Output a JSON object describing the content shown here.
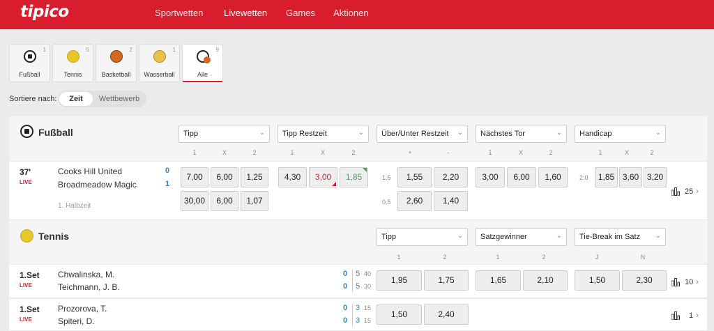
{
  "brand": {
    "logo": "tipico",
    "red": "#d81e2e"
  },
  "nav": [
    "Sportwetten",
    "Livewetten",
    "Games",
    "Aktionen"
  ],
  "sport_tabs": [
    {
      "label": "Fußball",
      "count": "1",
      "icon": "soccer-ball-icon"
    },
    {
      "label": "Tennis",
      "count": "5",
      "icon": "tennis-ball-icon"
    },
    {
      "label": "Basketball",
      "count": "2",
      "icon": "basketball-icon"
    },
    {
      "label": "Wasserball",
      "count": "1",
      "icon": "waterpolo-ball-icon"
    },
    {
      "label": "Alle",
      "count": "9",
      "icon": "all-sports-icon"
    }
  ],
  "sort": {
    "label": "Sortiere nach:",
    "options": [
      "Zeit",
      "Wettbewerb"
    ],
    "selected": "Zeit"
  },
  "football": {
    "title": "Fußball",
    "markets": [
      {
        "label": "Tipp",
        "cols": [
          "1",
          "X",
          "2"
        ]
      },
      {
        "label": "Tipp Restzeit",
        "cols": [
          "1",
          "X",
          "2"
        ]
      },
      {
        "label": "Über/Unter Restzeit",
        "cols": [
          "+",
          "-"
        ]
      },
      {
        "label": "Nächstes Tor",
        "cols": [
          "1",
          "X",
          "2"
        ]
      },
      {
        "label": "Handicap",
        "cols": [
          "1",
          "X",
          "2"
        ]
      }
    ],
    "match": {
      "time": "37'",
      "live": "LIVE",
      "team1": "Cooks Hill United",
      "team2": "Broadmeadow Magic",
      "score1": "0",
      "score2": "1",
      "period": "1. Halbzeit",
      "tipp": [
        "7,00",
        "6,00",
        "1,25"
      ],
      "tipp2": [
        "30,00",
        "6,00",
        "1,07"
      ],
      "restzeit": [
        "4,30",
        "3,00",
        "1,85"
      ],
      "ou_line1": "1,5",
      "ou1": [
        "1,55",
        "2,20"
      ],
      "ou_line2": "0,5",
      "ou2": [
        "2,60",
        "1,40"
      ],
      "next_goal": [
        "3,00",
        "6,00",
        "1,60"
      ],
      "hc_line": "2:0",
      "handicap": [
        "1,85",
        "3,60",
        "3,20"
      ],
      "more": "25"
    }
  },
  "tennis": {
    "title": "Tennis",
    "markets": [
      {
        "label": "Tipp",
        "cols": [
          "1",
          "2"
        ]
      },
      {
        "label": "Satzgewinner",
        "cols": [
          "1",
          "2"
        ]
      },
      {
        "label": "Tie-Break im Satz",
        "cols": [
          "J",
          "N"
        ]
      }
    ],
    "matches": [
      {
        "time": "1.Set",
        "live": "LIVE",
        "p1": "Chwalinska, M.",
        "p2": "Teichmann, J. B.",
        "s1": "0",
        "s2": "0",
        "g1": "5",
        "g2": "5",
        "pt1": "40",
        "pt2": "30",
        "tipp": [
          "1,95",
          "1,75"
        ],
        "set": [
          "1,65",
          "2,10"
        ],
        "tb": [
          "1,50",
          "2,30"
        ],
        "more": "10"
      },
      {
        "time": "1.Set",
        "live": "LIVE",
        "p1": "Prozorova, T.",
        "p2": "Spiteri, D.",
        "s1": "0",
        "s2": "0",
        "g1": "3",
        "g2": "3",
        "pt1": "15",
        "pt2": "15",
        "tipp": [
          "1,50",
          "2,40"
        ],
        "more": "1"
      }
    ]
  }
}
